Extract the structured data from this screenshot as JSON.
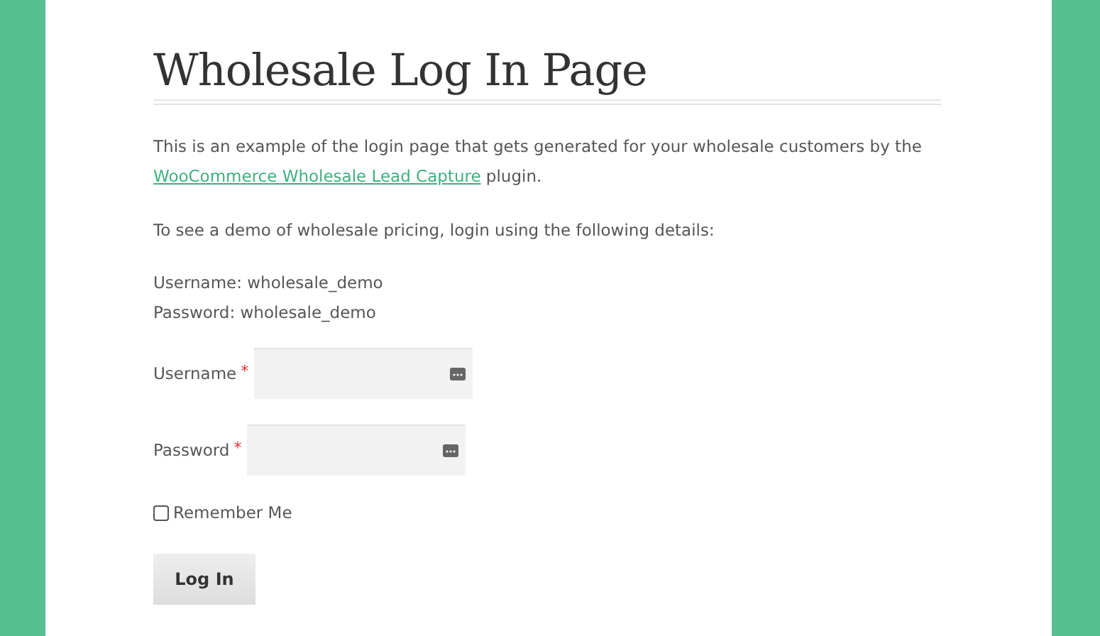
{
  "title": "Wholesale Log In Page",
  "intro": {
    "before": "This is an example of the login page that gets generated for your wholesale customers by the",
    "link": "WooCommerce Wholesale Lead Capture",
    "after": "plugin."
  },
  "demo_note": "To see a demo of wholesale pricing, login using the following details:",
  "credentials": [
    "Username: wholesale_demo",
    "Password: wholesale_demo"
  ],
  "fields": [
    {
      "label": "Username",
      "required_mark": "*"
    },
    {
      "label": "Password",
      "required_mark": "*"
    }
  ],
  "remember": {
    "label": "Remember Me",
    "checked": false
  },
  "submit": "Log In"
}
